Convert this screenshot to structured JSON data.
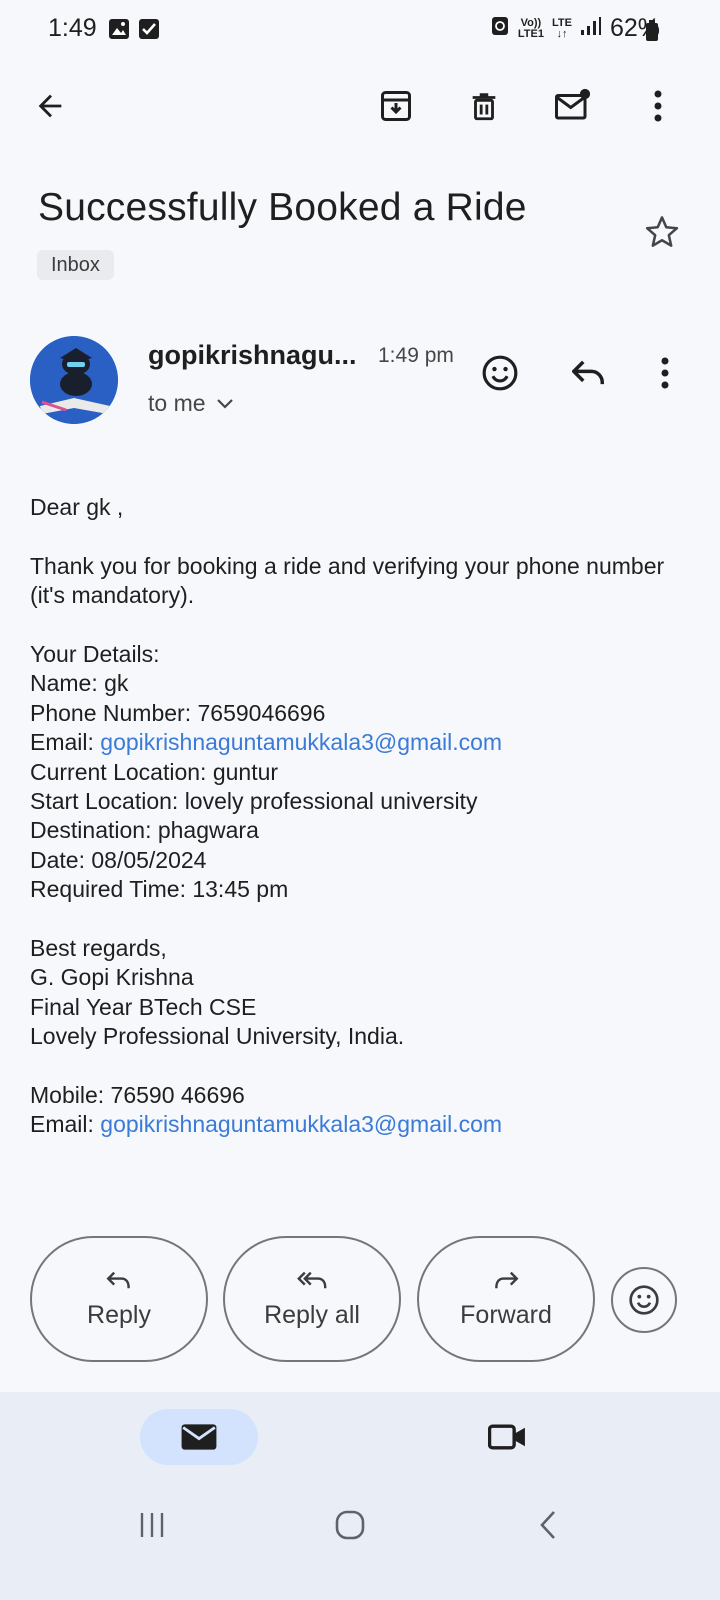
{
  "status_bar": {
    "time": "1:49",
    "battery": "62%",
    "network_top": "Vo))",
    "network_bottom": "LTE1",
    "lte": "LTE"
  },
  "email": {
    "subject": "Successfully Booked a Ride",
    "label": "Inbox",
    "sender": "gopikrishnagu...",
    "time": "1:49 pm",
    "recipient": "to me",
    "body": {
      "greeting": "Dear gk ,",
      "intro": "Thank you for booking a ride and verifying your phone number (it's mandatory).",
      "details_heading": "Your Details:",
      "name": "Name: gk",
      "phone": "Phone Number: 7659046696",
      "email_label": "Email: ",
      "email_value": "gopikrishnaguntamukkala3@gmail.com",
      "current_location": "Current Location: guntur",
      "start_location": "Start Location: lovely professional university",
      "destination": "Destination: phagwara",
      "date": "Date: 08/05/2024",
      "required_time": "Required Time: 13:45 pm",
      "sign_off": "Best regards,",
      "sig_name": "G. Gopi Krishna",
      "sig_title": "Final Year BTech CSE",
      "sig_org": "Lovely Professional University, India.",
      "mobile": "Mobile: 76590 46696",
      "sig_email_label": "Email: ",
      "sig_email_value": "gopikrishnaguntamukkala3@gmail.com"
    }
  },
  "actions": {
    "reply": "Reply",
    "reply_all": "Reply all",
    "forward": "Forward"
  },
  "icons": {
    "toolbar": [
      "back-arrow-icon",
      "archive-icon",
      "delete-icon",
      "mark-unread-icon",
      "more-vert-icon"
    ],
    "accent": "#3b7ad6",
    "nav_active_bg": "#d3e3fd"
  }
}
